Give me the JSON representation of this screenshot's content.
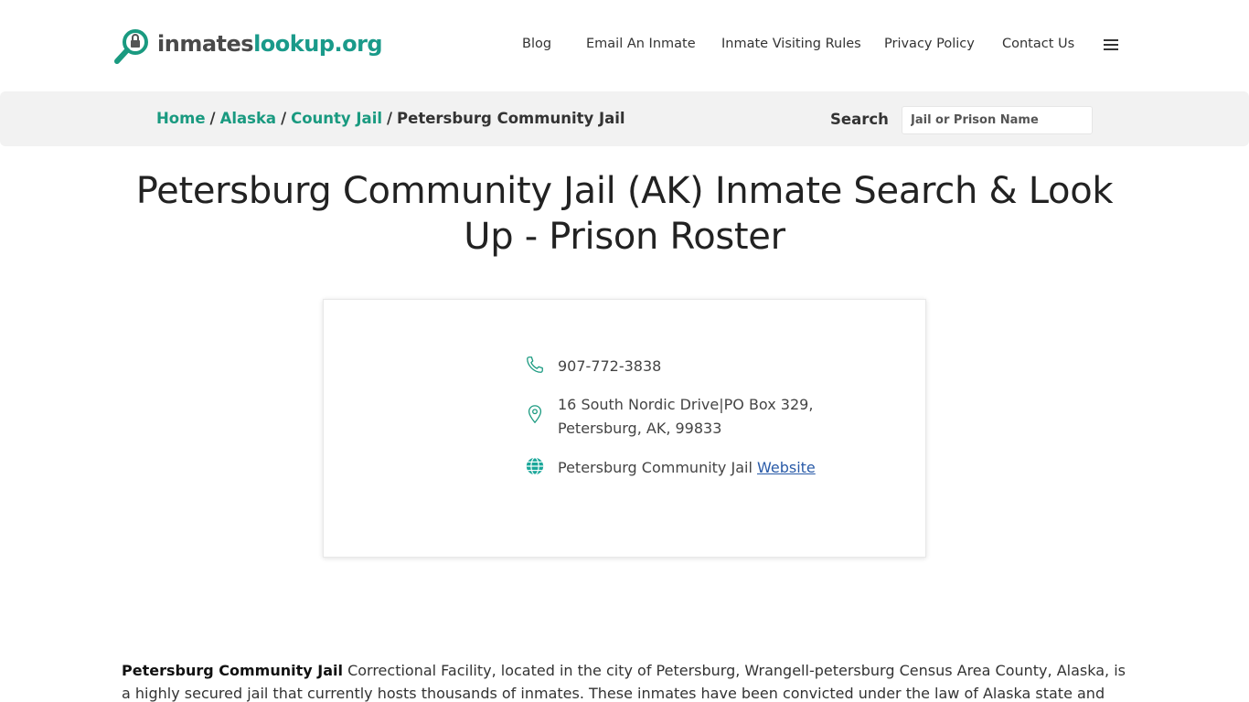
{
  "logo": {
    "part1": "inmates",
    "part2": "lookup.org",
    "icon": "magnifier-lock-icon"
  },
  "nav": {
    "items": [
      {
        "label": "Blog"
      },
      {
        "label": "Email An Inmate"
      },
      {
        "label": "Inmate Visiting Rules"
      },
      {
        "label": "Privacy Policy"
      },
      {
        "label": "Contact Us"
      }
    ],
    "menu_icon": "hamburger-icon"
  },
  "breadcrumb": {
    "home": "Home",
    "state": "Alaska",
    "category": "County Jail",
    "current": "Petersburg Community Jail",
    "separator": "/"
  },
  "search": {
    "label": "Search",
    "placeholder": "Jail or Prison Name"
  },
  "page_title": "Petersburg Community Jail (AK) Inmate Search & Look Up - Prison Roster",
  "contact": {
    "phone": "907-772-3838",
    "address_line1": "16 South Nordic Drive|PO Box 329,",
    "address_line2": "Petersburg, AK, 99833",
    "website_prefix": "Petersburg Community Jail",
    "website_link": "Website",
    "icons": {
      "phone": "phone-icon",
      "address": "map-pin-icon",
      "website": "globe-icon"
    }
  },
  "description": {
    "bold": "Petersburg Community Jail",
    "text": "Correctional Facility, located in the city of Petersburg, Wrangell-petersburg Census Area County, Alaska, is a highly secured jail that currently hosts thousands of inmates. These inmates have been convicted under the law of Alaska state and according to the"
  },
  "colors": {
    "brand_teal": "#1a9a80",
    "link_blue": "#2a5ba8",
    "bar_bg": "#f2f2f2"
  }
}
